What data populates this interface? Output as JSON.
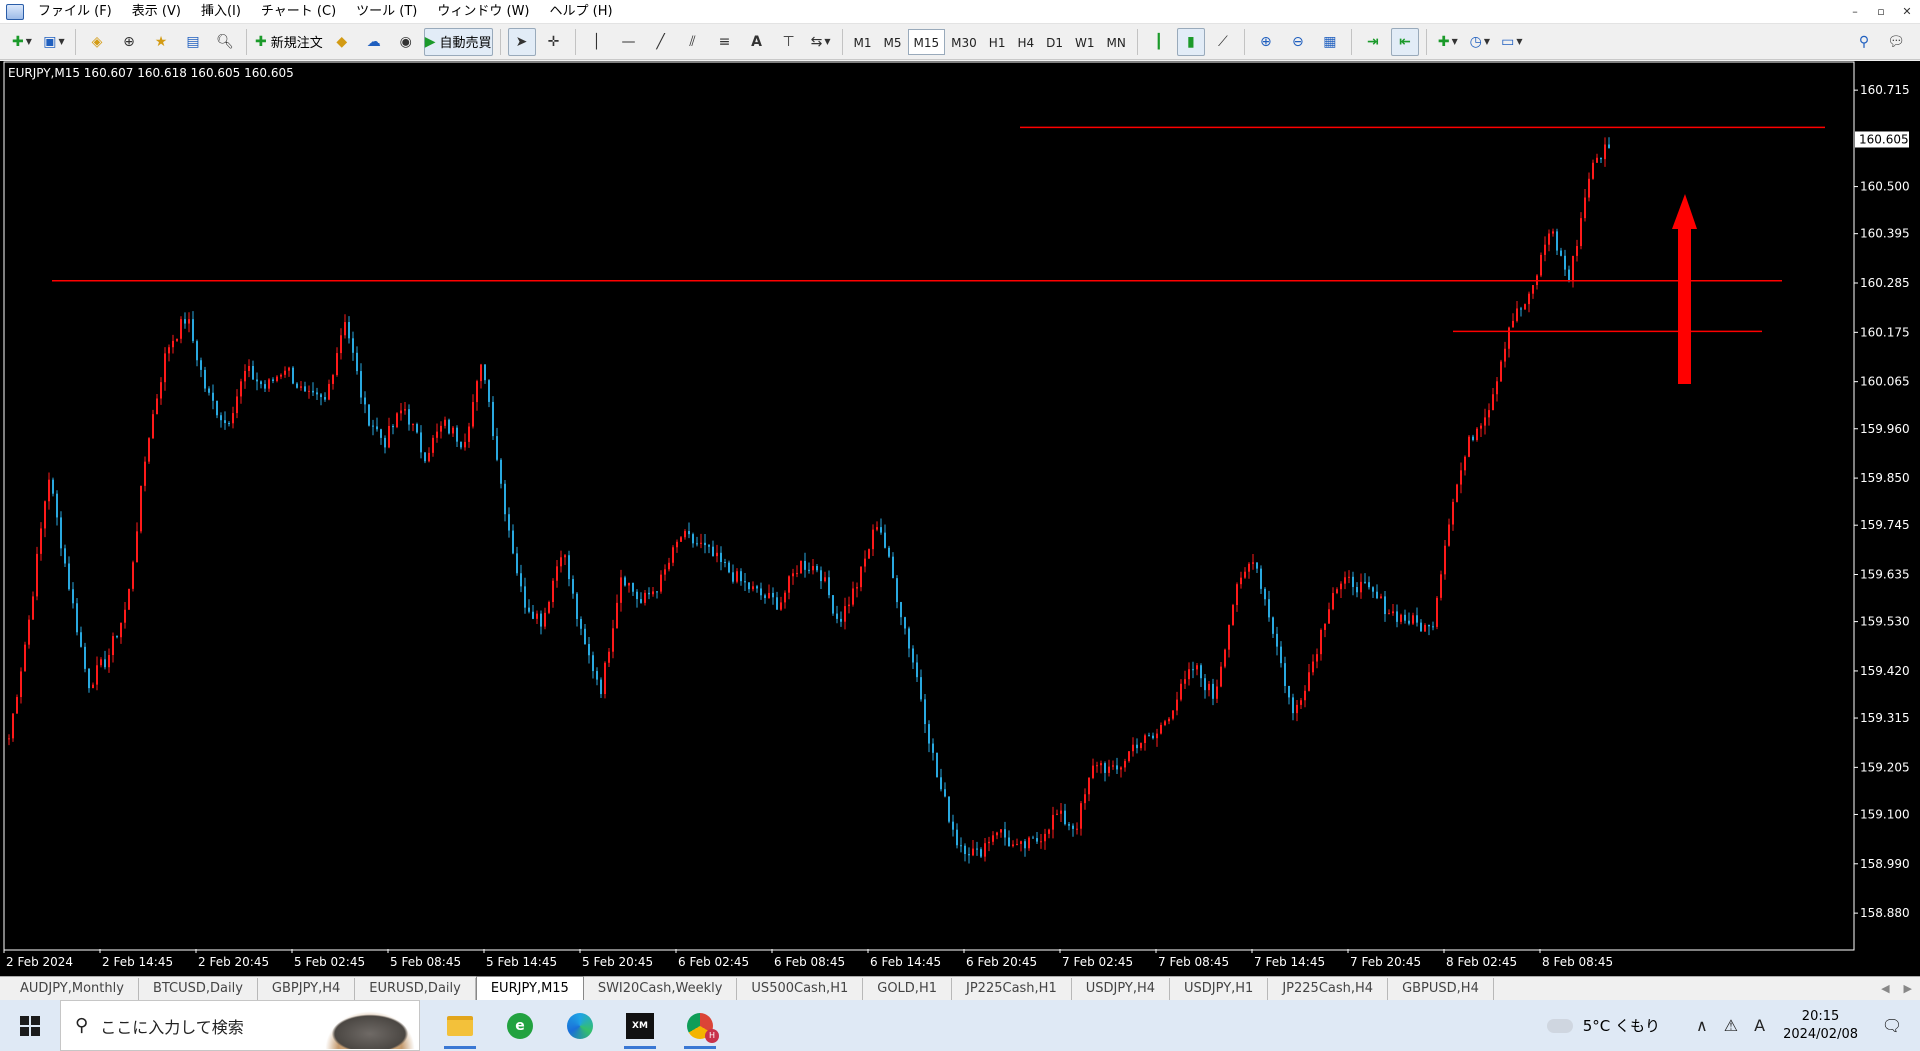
{
  "menubar": {
    "items": [
      "ファイル (F)",
      "表示 (V)",
      "挿入(I)",
      "チャート (C)",
      "ツール (T)",
      "ウィンドウ (W)",
      "ヘルプ (H)"
    ],
    "window_controls": [
      "–",
      "▫",
      "✕"
    ]
  },
  "toolbar": {
    "new_order_label": "新規注文",
    "auto_trade_label": "自動売買",
    "timeframes": [
      "M1",
      "M5",
      "M15",
      "M30",
      "H1",
      "H4",
      "D1",
      "W1",
      "MN"
    ],
    "active_timeframe": "M15"
  },
  "chart": {
    "header": "EURJPY,M15  160.607 160.618 160.605 160.605",
    "current_price_label": "160.605",
    "colors": {
      "bull": "#ff1a1a",
      "bear": "#29a9e0",
      "line": "#ff0000",
      "arrow": "#ff0000",
      "bg": "#000000",
      "text": "#ffffff"
    },
    "time_labels": [
      "2 Feb 2024",
      "2 Feb 14:45",
      "2 Feb 20:45",
      "5 Feb 02:45",
      "5 Feb 08:45",
      "5 Feb 14:45",
      "5 Feb 20:45",
      "6 Feb 02:45",
      "6 Feb 08:45",
      "6 Feb 14:45",
      "6 Feb 20:45",
      "7 Feb 02:45",
      "7 Feb 08:45",
      "7 Feb 14:45",
      "7 Feb 20:45",
      "8 Feb 02:45",
      "8 Feb 08:45"
    ],
    "price_labels": [
      "160.715",
      "160.500",
      "160.395",
      "160.285",
      "160.175",
      "160.065",
      "159.960",
      "159.850",
      "159.745",
      "159.635",
      "159.530",
      "159.420",
      "159.315",
      "159.205",
      "159.100",
      "158.990",
      "158.880"
    ],
    "horizontal_lines": [
      160.632,
      160.29,
      160.177
    ],
    "price_path": [
      159.27,
      159.53,
      159.86,
      159.62,
      159.39,
      159.45,
      159.57,
      159.93,
      160.14,
      160.21,
      160.04,
      159.97,
      160.09,
      160.05,
      160.1,
      160.03,
      160.02,
      160.21,
      160.0,
      159.93,
      160.01,
      159.9,
      159.97,
      159.93,
      160.11,
      159.81,
      159.58,
      159.53,
      159.7,
      159.49,
      159.38,
      159.64,
      159.57,
      159.62,
      159.72,
      159.7,
      159.66,
      159.62,
      159.59,
      159.57,
      159.66,
      159.65,
      159.53,
      159.62,
      159.76,
      159.58,
      159.4,
      159.18,
      159.04,
      159.01,
      159.07,
      159.02,
      159.04,
      159.1,
      159.07,
      159.22,
      159.19,
      159.26,
      159.27,
      159.35,
      159.43,
      159.36,
      159.58,
      159.68,
      159.51,
      159.32,
      159.44,
      159.6,
      159.62,
      159.59,
      159.55,
      159.53,
      159.51,
      159.79,
      159.94,
      160.02,
      160.2,
      160.25,
      160.41,
      160.29,
      160.53,
      160.6
    ]
  },
  "tabs": {
    "items": [
      "AUDJPY,Monthly",
      "BTCUSD,Daily",
      "GBPJPY,H4",
      "EURUSD,Daily",
      "EURJPY,M15",
      "SWI20Cash,Weekly",
      "US500Cash,H1",
      "GOLD,H1",
      "JP225Cash,H1",
      "USDJPY,H4",
      "USDJPY,H1",
      "JP225Cash,H4",
      "GBPUSD,H4"
    ],
    "active": "EURJPY,M15"
  },
  "taskbar": {
    "search_placeholder": "ここに入力して検索",
    "weather": "5°C くもり",
    "time": "20:15",
    "date": "2024/02/08",
    "ime": "A",
    "xm_label": "XM"
  }
}
